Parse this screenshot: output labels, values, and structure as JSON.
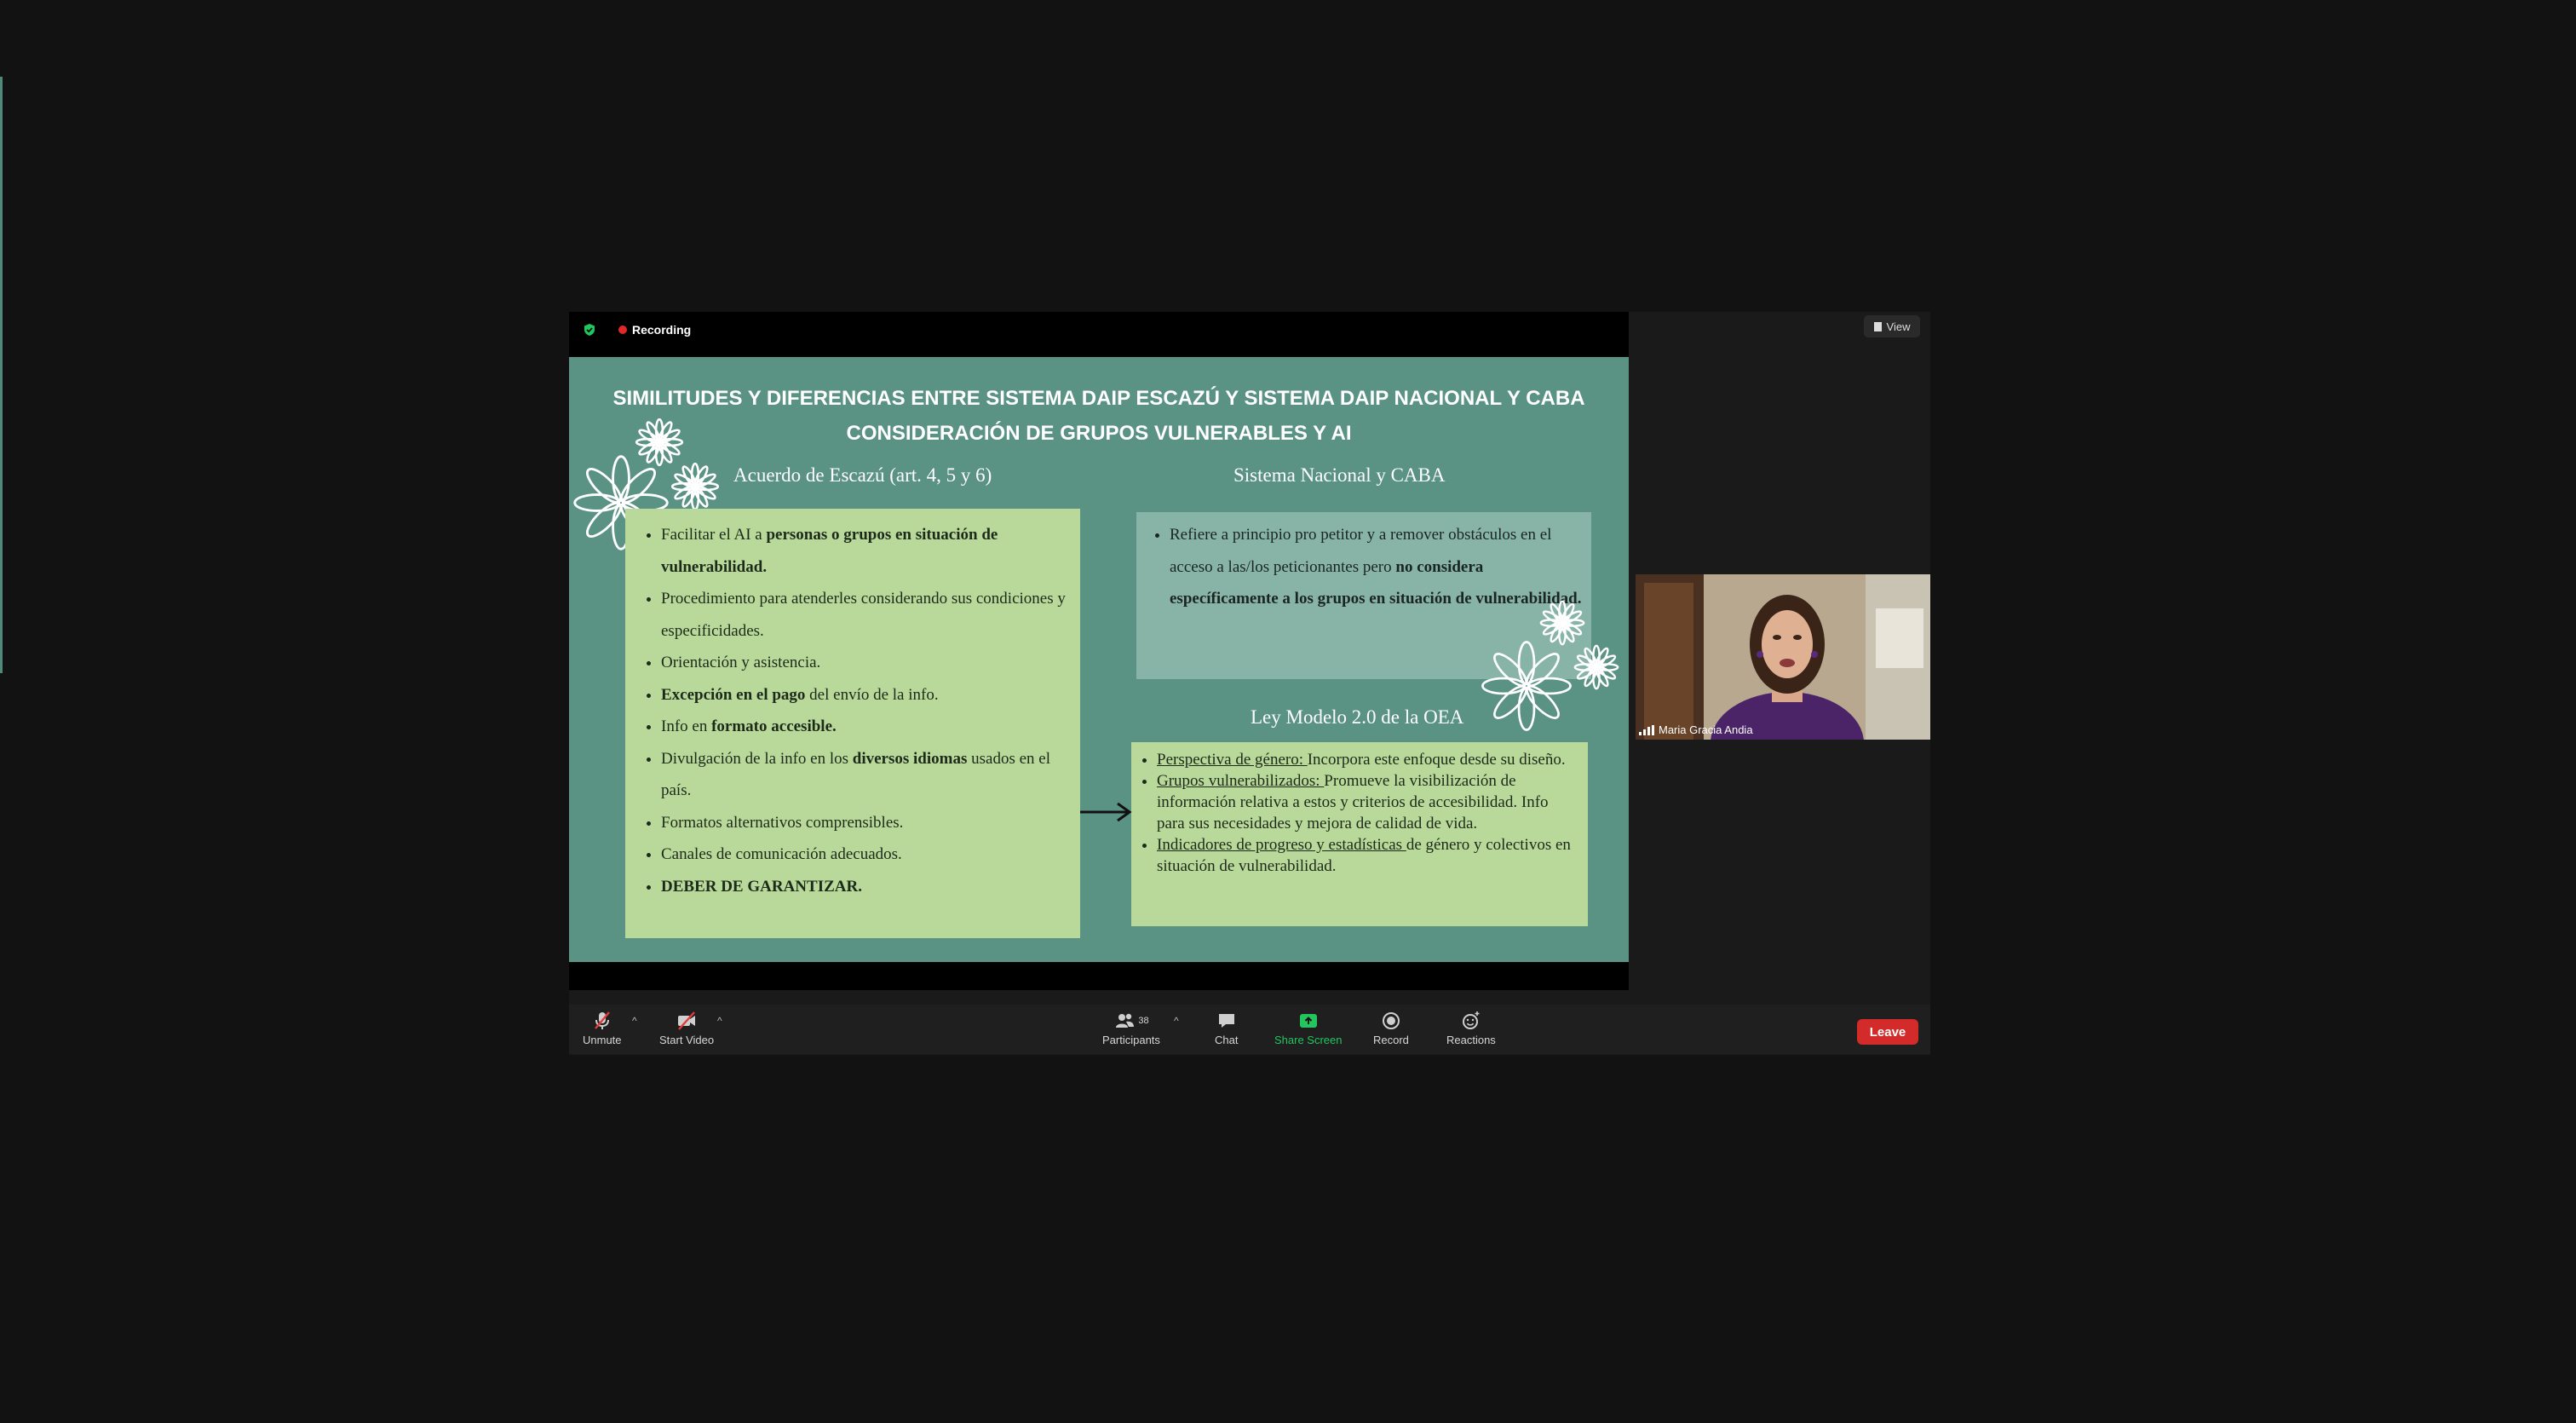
{
  "recording": {
    "label": "Recording"
  },
  "view": {
    "label": "View"
  },
  "slide": {
    "title_line1": "SIMILITUDES Y DIFERENCIAS ENTRE SISTEMA DAIP ESCAZÚ Y SISTEMA DAIP NACIONAL Y CABA",
    "title_line2": "CONSIDERACIÓN DE GRUPOS VULNERABLES Y AI",
    "left_heading": "Acuerdo de Escazú (art. 4, 5 y 6)",
    "left_items": [
      {
        "pre": "Facilitar el AI  a ",
        "bold": "personas o grupos en situación de vulnerabilidad.",
        "post": ""
      },
      {
        "pre": "Procedimiento para atenderles considerando sus condiciones y especificidades.",
        "bold": "",
        "post": ""
      },
      {
        "pre": "Orientación y asistencia.",
        "bold": "",
        "post": ""
      },
      {
        "pre": "",
        "bold": "Excepción en el pago",
        "post": " del envío de la info."
      },
      {
        "pre": "Info en ",
        "bold": "formato accesible.",
        "post": ""
      },
      {
        "pre": "Divulgación de la info en los ",
        "bold": "diversos idiomas",
        "post": " usados en el país."
      },
      {
        "pre": "Formatos alternativos comprensibles.",
        "bold": "",
        "post": ""
      },
      {
        "pre": "Canales de comunicación adecuados.",
        "bold": "",
        "post": ""
      },
      {
        "pre": "",
        "bold": "DEBER DE GARANTIZAR.",
        "post": ""
      }
    ],
    "right_heading": "Sistema Nacional y CABA",
    "right_item": {
      "pre": "Refiere a principio pro petitor y a remover obstáculos en el acceso a las/los peticionantes pero ",
      "bold": "no considera específicamente a los grupos en situación de vulnerabilidad."
    },
    "oea_heading": "Ley Modelo 2.0 de la OEA",
    "oea_items": [
      {
        "u": "Perspectiva de género: ",
        "rest": "Incorpora este enfoque desde su diseño."
      },
      {
        "u": "Grupos vulnerabilizados: ",
        "rest": "Promueve la visibilización de información relativa a estos y criterios de accesibilidad. Info para sus necesidades y mejora de calidad de vida."
      },
      {
        "u": "Indicadores de progreso y estadísticas ",
        "rest": "de género y colectivos en situación de vulnerabilidad."
      }
    ]
  },
  "participant_tile": {
    "name": "Maria Gracia Andia"
  },
  "toolbar": {
    "unmute": "Unmute",
    "start_video": "Start Video",
    "participants": "Participants",
    "participants_count": "38",
    "chat": "Chat",
    "share_screen": "Share Screen",
    "record": "Record",
    "reactions": "Reactions",
    "leave": "Leave"
  },
  "colors": {
    "slide_bg": "#5a9283",
    "green_box": "#b9d99a",
    "grey_box": "#88b4a8",
    "leave_red": "#d32a2a",
    "share_green": "#22c55e"
  }
}
